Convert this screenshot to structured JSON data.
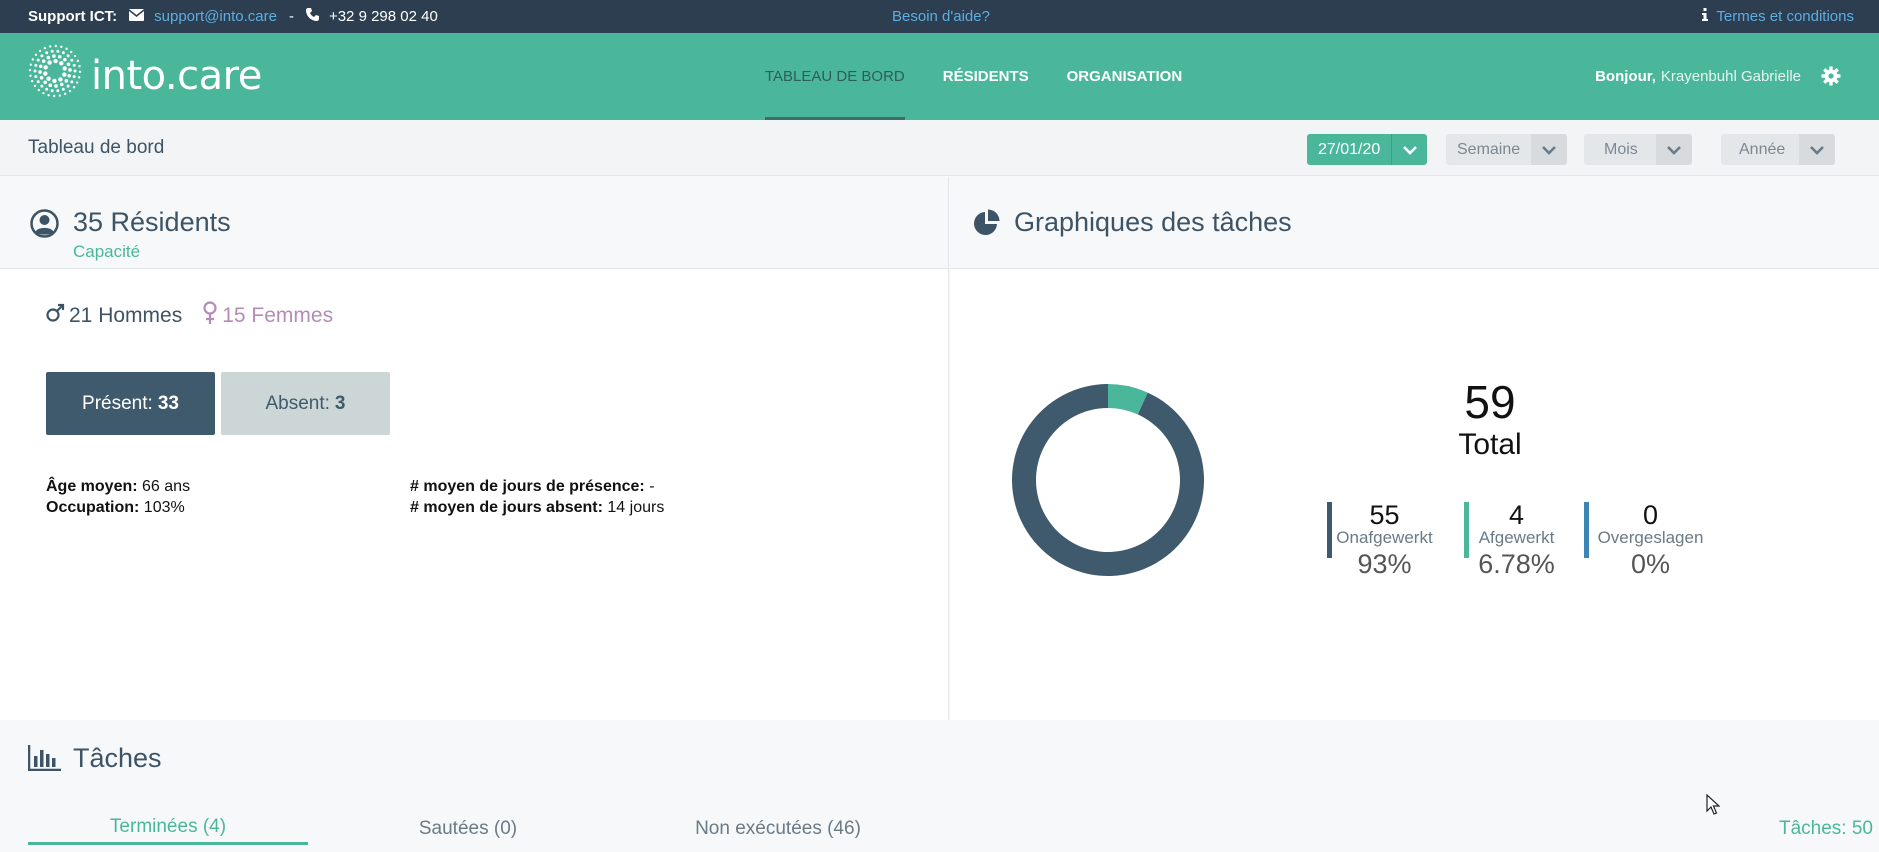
{
  "topbar": {
    "support_label": "Support ICT:",
    "email": "support@into.care",
    "separator": "-",
    "phone": "+32 9 298 02 40",
    "help": "Besoin d'aide?",
    "terms": "Termes et conditions"
  },
  "header": {
    "logo_text": "into.care",
    "nav": [
      "TABLEAU DE BORD",
      "RÉSIDENTS",
      "ORGANISATION"
    ],
    "greeting": "Bonjour,",
    "user_name": "Krayenbuhl Gabrielle"
  },
  "subheader": {
    "title": "Tableau de bord",
    "date": "27/01/20",
    "week": "Semaine",
    "month": "Mois",
    "year": "Année"
  },
  "residents": {
    "title": "35 Résidents",
    "subtitle": "Capacité",
    "men": "21 Hommes",
    "women": "15 Femmes",
    "present_label": "Présent:",
    "present_value": "33",
    "absent_label": "Absent:",
    "absent_value": "3",
    "age_label": "Âge moyen:",
    "age_value": "66 ans",
    "occupation_label": "Occupation:",
    "occupation_value": "103%",
    "presence_days_label": "# moyen de jours de présence:",
    "presence_days_value": "-",
    "absent_days_label": "# moyen de jours absent:",
    "absent_days_value": "14 jours"
  },
  "graph": {
    "title": "Graphiques des tâches",
    "total_value": "59",
    "total_label": "Total",
    "legend": [
      {
        "value": "55",
        "label": "Onafgewerkt",
        "pct": "93%",
        "color": "#3f5a6c"
      },
      {
        "value": "4",
        "label": "Afgewerkt",
        "pct": "6.78%",
        "color": "#4ab79b"
      },
      {
        "value": "0",
        "label": "Overgeslagen",
        "pct": "0%",
        "color": "#3b86b5"
      }
    ]
  },
  "chart_data": {
    "type": "pie",
    "categories": [
      "Onafgewerkt",
      "Afgewerkt",
      "Overgeslagen"
    ],
    "values": [
      55,
      4,
      0
    ],
    "colors": [
      "#3f5a6c",
      "#4ab79b",
      "#3b86b5"
    ]
  },
  "tasks": {
    "title": "Tâches",
    "tabs": [
      "Terminées (4)",
      "Sautées (0)",
      "Non exécutées (46)"
    ],
    "count": "Tâches: 50"
  }
}
